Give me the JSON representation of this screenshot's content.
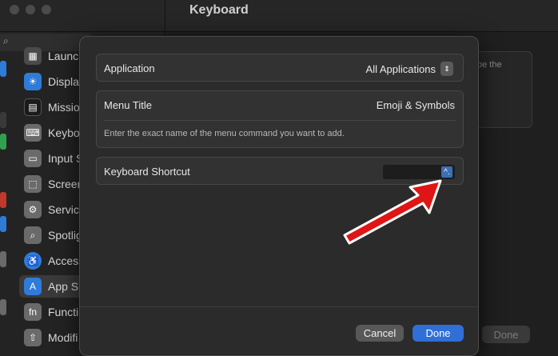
{
  "window": {
    "title": "Keyboard"
  },
  "sidebar": {
    "items": [
      {
        "label": "Launc",
        "icon": "launchpad-icon",
        "color": "#3b3b3b"
      },
      {
        "label": "Displa",
        "icon": "display-icon",
        "color": "#2f7bd8"
      },
      {
        "label": "Missio",
        "icon": "mission-control-icon",
        "color": "#1c1c1c"
      },
      {
        "label": "Keybo",
        "icon": "keyboard-icon",
        "color": "#6a6a6a"
      },
      {
        "label": "Input S",
        "icon": "input-sources-icon",
        "color": "#6a6a6a"
      },
      {
        "label": "Screen",
        "icon": "screenshot-icon",
        "color": "#6a6a6a"
      },
      {
        "label": "Servic",
        "icon": "services-icon",
        "color": "#6a6a6a"
      },
      {
        "label": "Spotlig",
        "icon": "spotlight-icon",
        "color": "#6a6a6a"
      },
      {
        "label": "Access",
        "icon": "accessibility-icon",
        "color": "#2f7bd8"
      },
      {
        "label": "App S",
        "icon": "app-store-icon",
        "color": "#2f7bd8"
      },
      {
        "label": "Functi",
        "icon": "function-keys-icon",
        "color": "#6a6a6a"
      },
      {
        "label": "Modifi",
        "icon": "modifier-keys-icon",
        "color": "#6a6a6a"
      }
    ]
  },
  "background": {
    "panel_text": "pe the",
    "done_label": "Done"
  },
  "sheet": {
    "application_label": "Application",
    "application_value": "All Applications",
    "menu_title_label": "Menu Title",
    "menu_title_value": "Emoji & Symbols",
    "menu_title_help": "Enter the exact name of the menu command you want to add.",
    "shortcut_label": "Keyboard Shortcut",
    "shortcut_value": "^.",
    "cancel_label": "Cancel",
    "done_label": "Done"
  },
  "colors": {
    "accent": "#2f6fd6",
    "annotation_arrow": "#e01515"
  }
}
